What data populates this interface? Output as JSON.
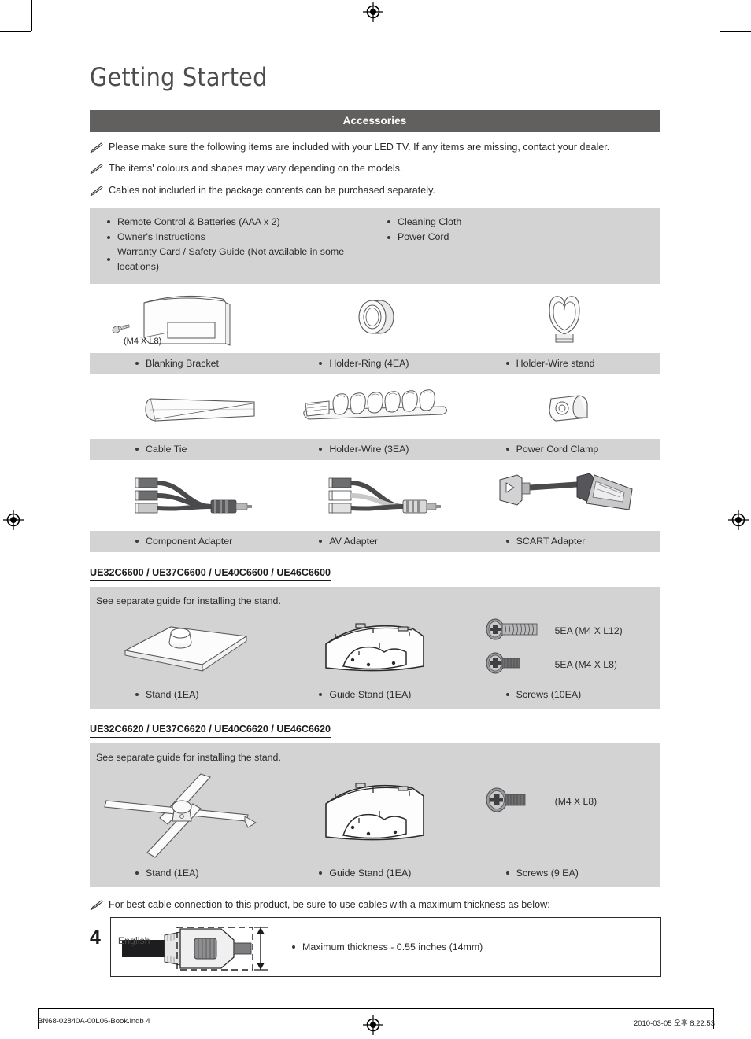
{
  "document": {
    "title": "Getting Started",
    "section_header": "Accessories",
    "page_number": "4",
    "language": "English"
  },
  "notes": [
    "Please make sure the following items are included with your LED TV. If any items are missing, contact your dealer.",
    "The items' colours and shapes may vary depending on the models.",
    "Cables not included in the package contents can be purchased separately."
  ],
  "included_items": {
    "column_one": [
      "Remote Control & Batteries (AAA x 2)",
      "Owner's Instructions",
      "Warranty Card / Safety Guide (Not available in some locations)"
    ],
    "column_two": [
      "Cleaning Cloth",
      "Power Cord"
    ]
  },
  "accessory_rows": [
    {
      "items": [
        {
          "label": "Blanking Bracket",
          "annotation": "(M4 X L8)"
        },
        {
          "label": "Holder-Ring (4EA)",
          "annotation": ""
        },
        {
          "label": "Holder-Wire stand",
          "annotation": ""
        }
      ]
    },
    {
      "items": [
        {
          "label": "Cable Tie",
          "annotation": ""
        },
        {
          "label": "Holder-Wire (3EA)",
          "annotation": ""
        },
        {
          "label": "Power Cord Clamp",
          "annotation": ""
        }
      ]
    },
    {
      "items": [
        {
          "label": "Component Adapter",
          "annotation": ""
        },
        {
          "label": "AV Adapter",
          "annotation": ""
        },
        {
          "label": "SCART Adapter",
          "annotation": ""
        }
      ]
    }
  ],
  "stand_sections": [
    {
      "models": "UE32C6600 / UE37C6600 / UE40C6600 / UE46C6600",
      "note": "See separate guide for installing the stand.",
      "screw_labels": [
        "5EA (M4 X L12)",
        "5EA (M4 X L8)"
      ],
      "captions": [
        "Stand (1EA)",
        "Guide Stand (1EA)",
        "Screws (10EA)"
      ]
    },
    {
      "models": "UE32C6620 / UE37C6620 / UE40C6620 / UE46C6620",
      "note": "See separate guide for installing the stand.",
      "screw_labels": [
        "(M4 X L8)"
      ],
      "captions": [
        "Stand (1EA)",
        "Guide Stand (1EA)",
        "Screws (9 EA)"
      ]
    }
  ],
  "cable_section": {
    "note": "For best cable connection to this product, be sure to use cables with a maximum thickness as below:",
    "caption": "Maximum thickness - 0.55 inches (14mm)"
  },
  "print_footer": {
    "left": "BN68-02840A-00L06-Book.indb   4",
    "right": "2010-03-05   오후 8:22:53"
  },
  "colors": {
    "section_bar": "#625f5f",
    "panel_grey": "#d3d3d3",
    "title_grey": "#4c4c4c",
    "text": "#2b2b2b"
  }
}
